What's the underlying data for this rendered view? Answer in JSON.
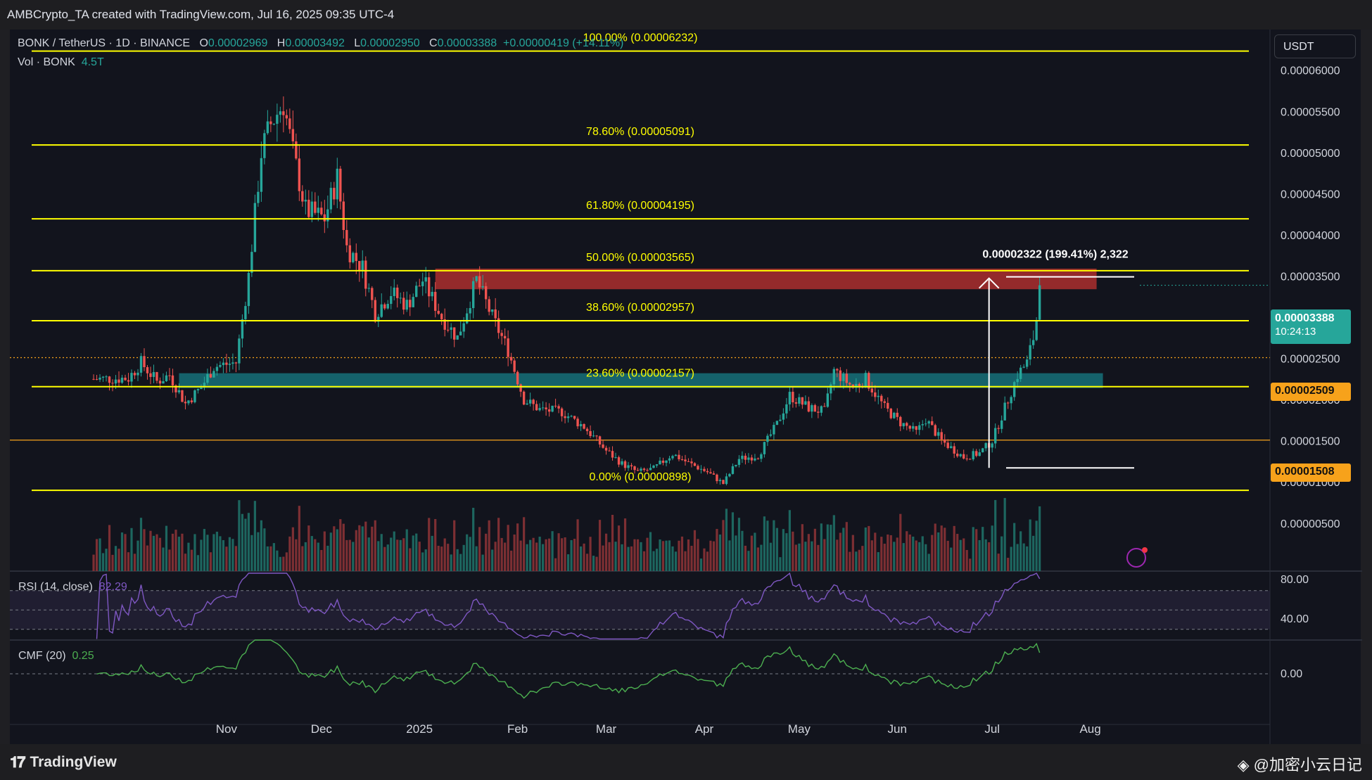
{
  "header": {
    "caption": "AMBCrypto_TA created with TradingView.com, Jul 16, 2025 09:35 UTC-4"
  },
  "legend": {
    "symbol": "BONK / TetherUS · 1D · BINANCE",
    "o_label": "O",
    "o_value": "0.00002969",
    "h_label": "H",
    "h_value": "0.00003492",
    "l_label": "L",
    "l_value": "0.00002950",
    "c_label": "C",
    "c_value": "0.00003388",
    "change": "+0.00000419 (+14.11%)",
    "vol_label": "Vol · BONK",
    "vol_value": "4.5T"
  },
  "currency_button": "USDT",
  "last_price": {
    "value": "0.00003388",
    "countdown": "10:24:13",
    "color": "#26a69a"
  },
  "level_tags": [
    {
      "value": "0.00002509",
      "color": "#f7a21b"
    },
    {
      "value": "0.00001508",
      "color": "#f7a21b"
    }
  ],
  "measure_label": "0.00002322 (199.41%) 2,322",
  "rsi": {
    "label": "RSI (14, close)",
    "value": "82.29",
    "axis": [
      "80.00",
      "40.00"
    ]
  },
  "cmf": {
    "label": "CMF (20)",
    "value": "0.25",
    "axis": [
      "0.00"
    ]
  },
  "brand": {
    "name": "TradingView",
    "watermark": "@加密小云日记"
  },
  "colors": {
    "up": "#26a69a",
    "down": "#ef5350",
    "fib": "#ffff00",
    "rsi": "#7e57c2",
    "cmf": "#4caf50",
    "background": "#12141d"
  },
  "chart_data": {
    "type": "candlestick",
    "ylim": [
      3.5e-06,
      6.6e-06
    ],
    "y_ticks": [
      "0.00006000",
      "0.00005500",
      "0.00005000",
      "0.00004500",
      "0.00004000",
      "0.00003500",
      "0.00003000",
      "0.00002500",
      "0.00002000",
      "0.00001500",
      "0.00001000",
      "0.00000500"
    ],
    "x_ticks": [
      "Nov",
      "Dec",
      "2025",
      "Feb",
      "Mar",
      "Apr",
      "May",
      "Jun",
      "Jul",
      "Aug"
    ],
    "fib_levels": [
      {
        "label": "100.00% (0.00006232)",
        "value": 6.232e-05
      },
      {
        "label": "78.60% (0.00005091)",
        "value": 5.091e-05
      },
      {
        "label": "61.80% (0.00004195)",
        "value": 4.195e-05
      },
      {
        "label": "50.00% (0.00003565)",
        "value": 3.565e-05
      },
      {
        "label": "38.60% (0.00002957)",
        "value": 2.957e-05
      },
      {
        "label": "23.60% (0.00002157)",
        "value": 2.157e-05
      },
      {
        "label": "0.00% (0.00000898)",
        "value": 8.98e-06
      }
    ],
    "zones": [
      {
        "name": "resistance",
        "from_date": "2025-01-06",
        "to_date": "2025-08-03",
        "low": 3.34e-05,
        "high": 3.59e-05,
        "color": "#b8312f"
      },
      {
        "name": "support",
        "from_date": "2024-10-17",
        "to_date": "2025-08-05",
        "low": 2.14e-05,
        "high": 2.32e-05,
        "color": "#167982"
      }
    ],
    "hlines": [
      {
        "value": 2.509e-05,
        "style": "dotted",
        "color": "#f7a21b"
      },
      {
        "value": 1.508e-05,
        "style": "solid",
        "color": "#f7a21b"
      }
    ],
    "measure": {
      "from": 1.17e-05,
      "to": 3.49e-05,
      "date": "2025-06-30"
    },
    "anchors": [
      [
        "2024-09-20",
        2.25e-05
      ],
      [
        "2024-10-01",
        2.26e-05
      ],
      [
        "2024-10-05",
        2.45e-05
      ],
      [
        "2024-10-10",
        2.22e-05
      ],
      [
        "2024-10-14",
        2.3e-05
      ],
      [
        "2024-10-19",
        1.95e-05
      ],
      [
        "2024-10-24",
        2.15e-05
      ],
      [
        "2024-10-28",
        2.4e-05
      ],
      [
        "2024-11-04",
        2.45e-05
      ],
      [
        "2024-11-08",
        3.5e-05
      ],
      [
        "2024-11-12",
        5e-05
      ],
      [
        "2024-11-15",
        5.35e-05
      ],
      [
        "2024-11-19",
        5.6e-05
      ],
      [
        "2024-11-22",
        5e-05
      ],
      [
        "2024-11-26",
        4.3e-05
      ],
      [
        "2024-12-02",
        4.2e-05
      ],
      [
        "2024-12-06",
        4.7e-05
      ],
      [
        "2024-12-09",
        3.85e-05
      ],
      [
        "2024-12-14",
        3.6e-05
      ],
      [
        "2024-12-18",
        3.05e-05
      ],
      [
        "2024-12-23",
        3.3e-05
      ],
      [
        "2024-12-28",
        3.15e-05
      ],
      [
        "2025-01-02",
        3.45e-05
      ],
      [
        "2025-01-08",
        3e-05
      ],
      [
        "2025-01-13",
        2.75e-05
      ],
      [
        "2025-01-19",
        3.45e-05
      ],
      [
        "2025-01-24",
        3e-05
      ],
      [
        "2025-01-29",
        2.6e-05
      ],
      [
        "2025-02-03",
        2e-05
      ],
      [
        "2025-02-08",
        1.88e-05
      ],
      [
        "2025-02-15",
        1.85e-05
      ],
      [
        "2025-02-22",
        1.67e-05
      ],
      [
        "2025-03-01",
        1.38e-05
      ],
      [
        "2025-03-06",
        1.22e-05
      ],
      [
        "2025-03-11",
        1.12e-05
      ],
      [
        "2025-03-16",
        1.16e-05
      ],
      [
        "2025-03-22",
        1.34e-05
      ],
      [
        "2025-03-27",
        1.23e-05
      ],
      [
        "2025-04-02",
        1.12e-05
      ],
      [
        "2025-04-07",
        9.8e-06
      ],
      [
        "2025-04-12",
        1.28e-05
      ],
      [
        "2025-04-18",
        1.32e-05
      ],
      [
        "2025-04-24",
        1.7e-05
      ],
      [
        "2025-04-28",
        2.05e-05
      ],
      [
        "2025-05-04",
        1.9e-05
      ],
      [
        "2025-05-09",
        1.85e-05
      ],
      [
        "2025-05-12",
        2.35e-05
      ],
      [
        "2025-05-18",
        2.15e-05
      ],
      [
        "2025-05-22",
        2.25e-05
      ],
      [
        "2025-05-28",
        1.9e-05
      ],
      [
        "2025-06-02",
        1.72e-05
      ],
      [
        "2025-06-07",
        1.6e-05
      ],
      [
        "2025-06-10",
        1.76e-05
      ],
      [
        "2025-06-15",
        1.5e-05
      ],
      [
        "2025-06-22",
        1.3e-05
      ],
      [
        "2025-06-27",
        1.35e-05
      ],
      [
        "2025-07-01",
        1.5e-05
      ],
      [
        "2025-07-05",
        1.9e-05
      ],
      [
        "2025-07-09",
        2.3e-05
      ],
      [
        "2025-07-12",
        2.45e-05
      ],
      [
        "2025-07-14",
        2.75e-05
      ],
      [
        "2025-07-15",
        2.97e-05
      ],
      [
        "2025-07-16",
        3.39e-05
      ]
    ]
  }
}
